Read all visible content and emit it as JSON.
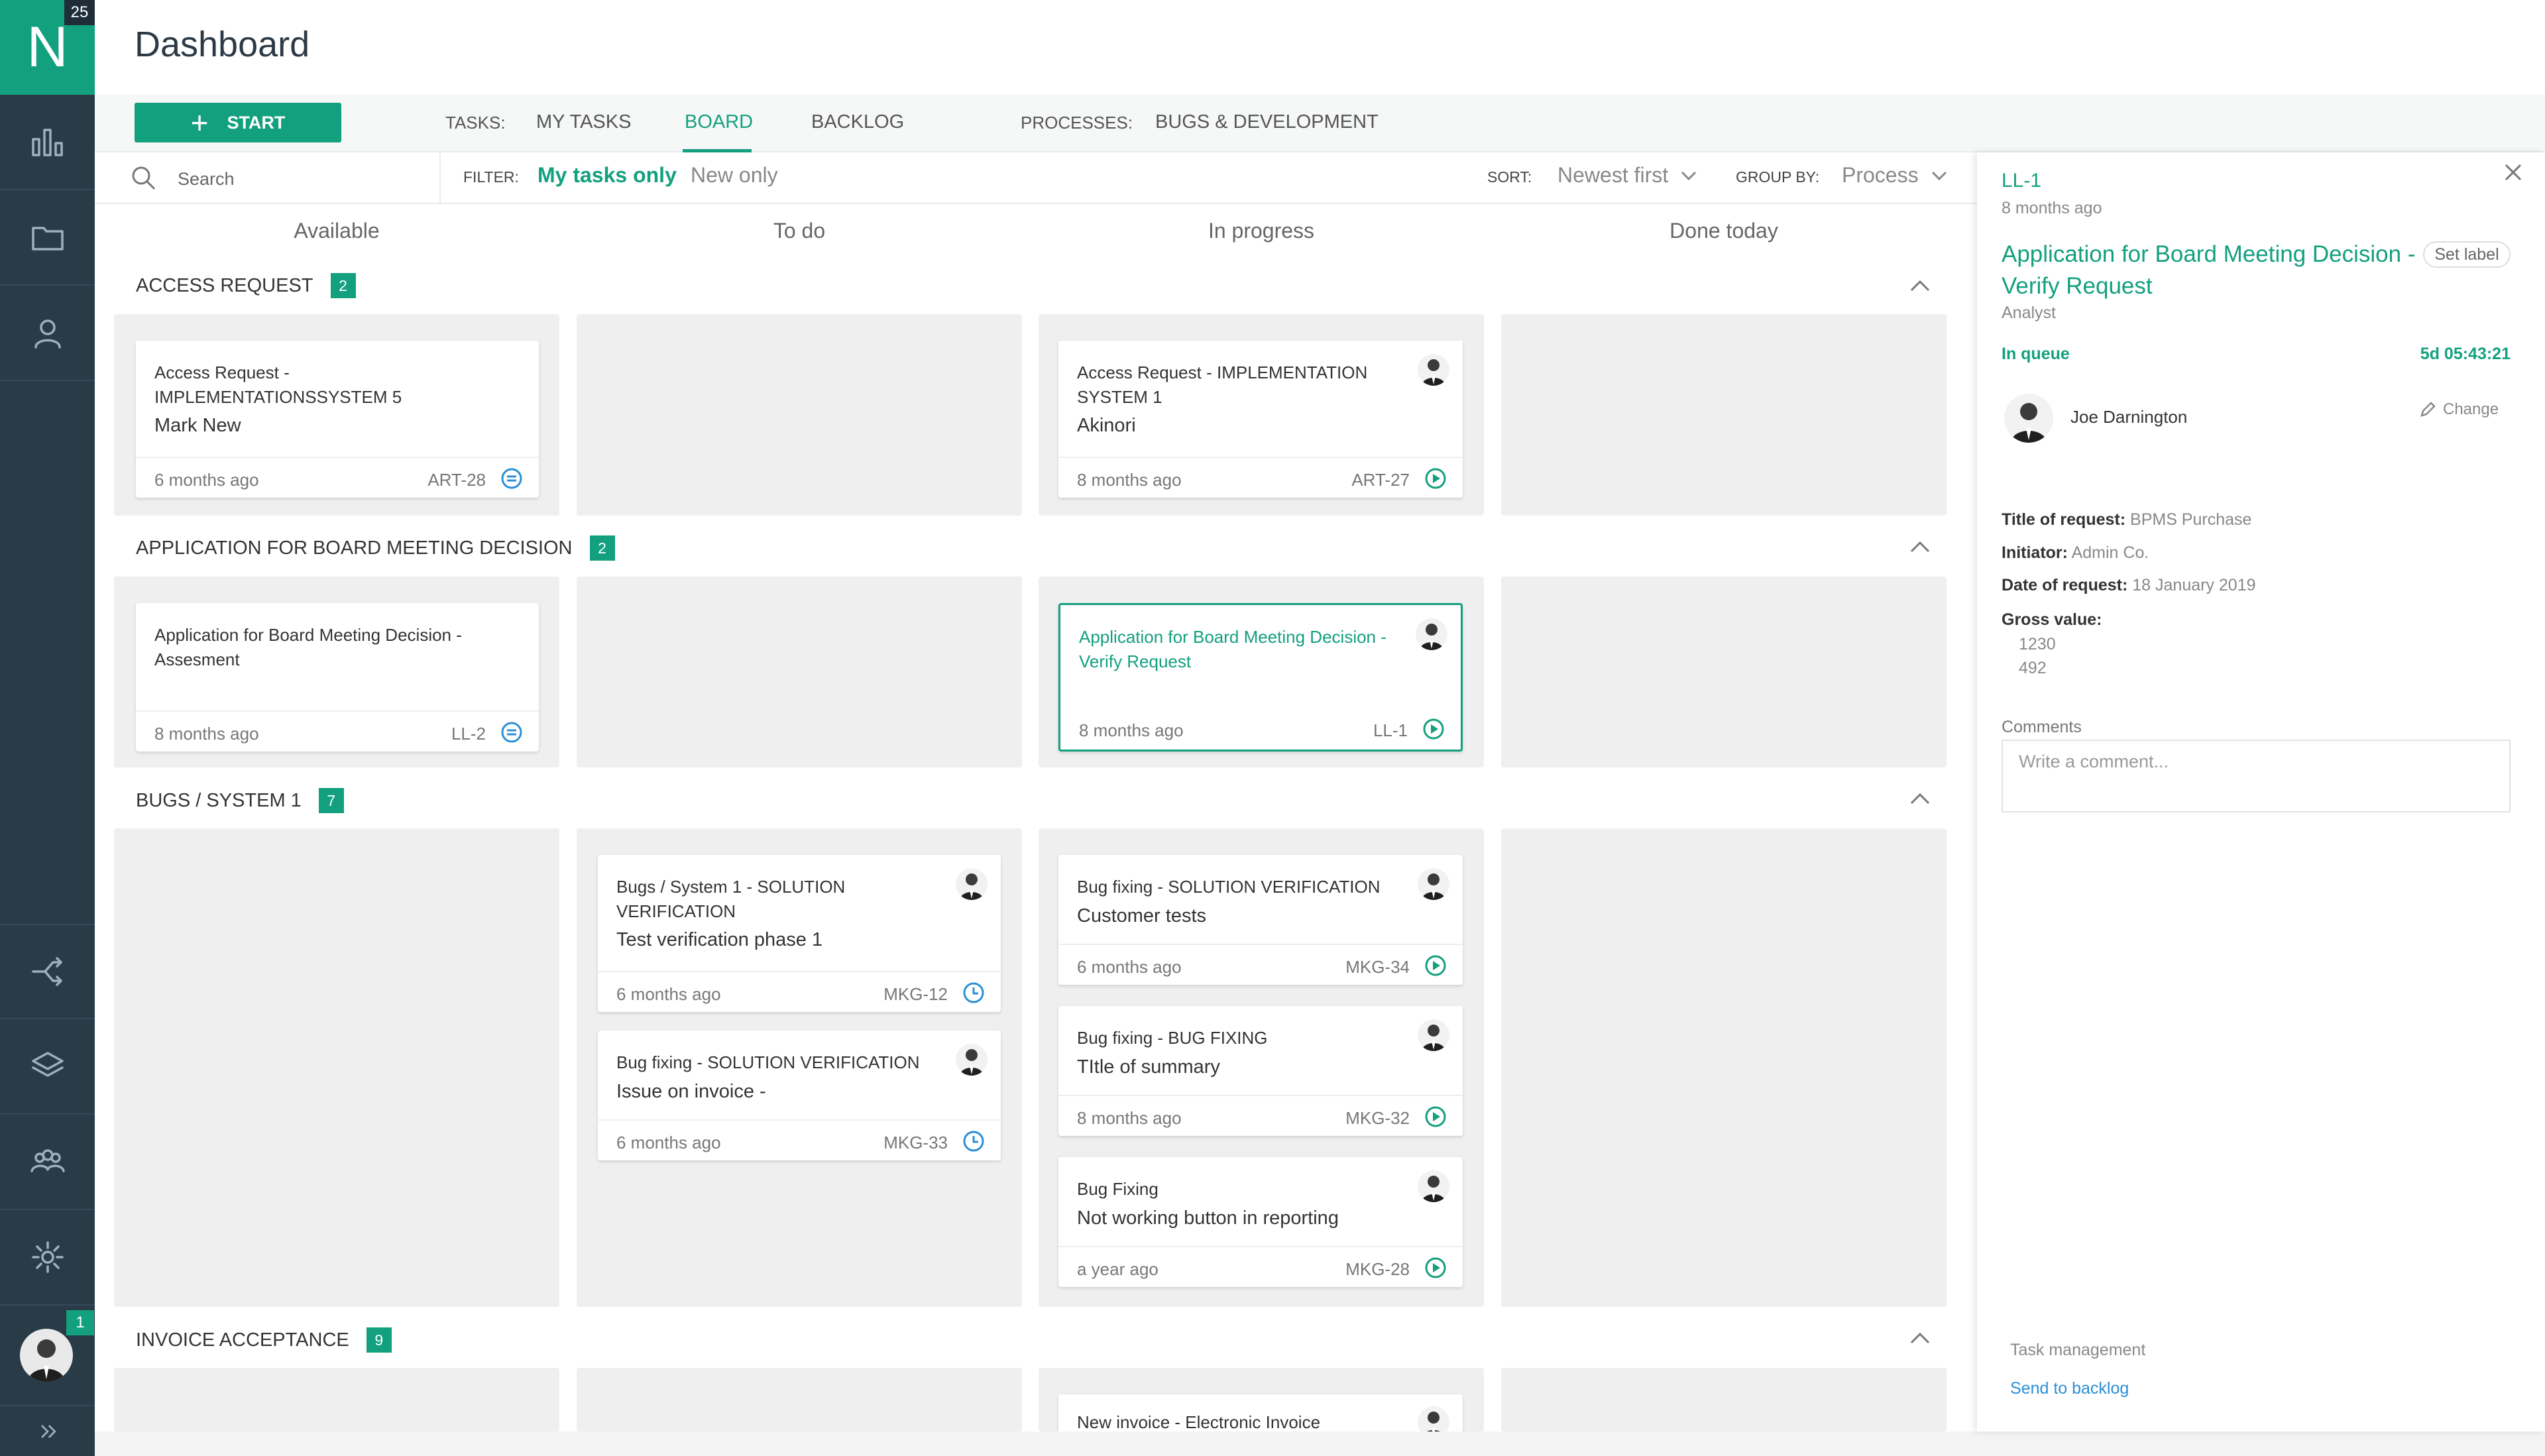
{
  "app": {
    "logo_letter": "N",
    "logo_badge": "25",
    "avatar_badge": "1"
  },
  "page": {
    "title": "Dashboard"
  },
  "sidebar": {
    "items": [
      {
        "icon": "bar-chart-icon"
      },
      {
        "icon": "folder-icon"
      },
      {
        "icon": "user-icon"
      },
      {
        "icon": "share-icon"
      },
      {
        "icon": "layers-icon"
      },
      {
        "icon": "team-icon"
      },
      {
        "icon": "gear-icon"
      }
    ],
    "expand_icon": "double-chevron-right-icon"
  },
  "toolbar": {
    "start_label": "START",
    "tasks_label": "TASKS:",
    "tabs": [
      {
        "label": "MY TASKS",
        "active": false
      },
      {
        "label": "BOARD",
        "active": true
      },
      {
        "label": "BACKLOG",
        "active": false
      }
    ],
    "processes_label": "PROCESSES:",
    "process_tab": "BUGS & DEVELOPMENT"
  },
  "filterbar": {
    "search_placeholder": "Search",
    "filter_label": "FILTER:",
    "filter_options": [
      {
        "label": "My tasks only",
        "active": true
      },
      {
        "label": "New only",
        "active": false
      }
    ],
    "sort_label": "SORT:",
    "sort_value": "Newest first",
    "group_label": "GROUP BY:",
    "group_value": "Process"
  },
  "board": {
    "columns": [
      "Available",
      "To do",
      "In progress",
      "Done today"
    ],
    "groups": [
      {
        "name": "ACCESS REQUEST",
        "count": "2",
        "cards": [
          {
            "title": "Access Request - IMPLEMENTATIONSSYSTEM 5",
            "subtitle": "Mark New",
            "date": "6 months ago",
            "id": "ART-28",
            "status": "list",
            "avatar": false
          },
          {
            "title": "Access Request - IMPLEMENTATION SYSTEM 1",
            "subtitle": "Akinori",
            "date": "8 months ago",
            "id": "ART-27",
            "status": "play",
            "avatar": true
          }
        ]
      },
      {
        "name": "APPLICATION FOR BOARD MEETING DECISION",
        "count": "2",
        "cards": [
          {
            "title": "Application for Board Meeting Decision - Assesment",
            "subtitle": "",
            "date": "8 months ago",
            "id": "LL-2",
            "status": "list",
            "avatar": false
          },
          {
            "title": "Application for Board Meeting Decision - Verify Request",
            "subtitle": "",
            "date": "8 months ago",
            "id": "LL-1",
            "status": "play",
            "avatar": true,
            "selected": true
          }
        ]
      },
      {
        "name": "BUGS / SYSTEM 1",
        "count": "7",
        "cards": [
          {
            "title": "Bugs / System 1 - SOLUTION VERIFICATION",
            "subtitle": "Test verification phase 1",
            "date": "6 months ago",
            "id": "MKG-12",
            "status": "clock",
            "avatar": true
          },
          {
            "title": "Bug fixing - SOLUTION VERIFICATION",
            "subtitle": "Issue on invoice -",
            "date": "6 months ago",
            "id": "MKG-33",
            "status": "clock",
            "avatar": true
          },
          {
            "title": "Bug fixing - SOLUTION VERIFICATION",
            "subtitle": "Customer tests",
            "date": "6 months ago",
            "id": "MKG-34",
            "status": "play",
            "avatar": true
          },
          {
            "title": "Bug fixing - BUG FIXING",
            "subtitle": "TItle of summary",
            "date": "8 months ago",
            "id": "MKG-32",
            "status": "play",
            "avatar": true
          },
          {
            "title": "Bug Fixing",
            "subtitle": "Not working button in reporting",
            "date": "a year ago",
            "id": "MKG-28",
            "status": "play",
            "avatar": true
          }
        ]
      },
      {
        "name": "INVOICE ACCEPTANCE",
        "count": "9",
        "cards": [
          {
            "title": "New invoice - Electronic Invoice",
            "subtitle": "",
            "date": "",
            "id": "",
            "status": "",
            "avatar": true
          }
        ]
      }
    ]
  },
  "panel": {
    "id": "LL-1",
    "age": "8 months ago",
    "title": "Application for Board Meeting Decision - Verify Request",
    "set_label": "Set label",
    "role": "Analyst",
    "status": "In queue",
    "timer": "5d 05:43:21",
    "assignee": "Joe Darnington",
    "change_label": "Change",
    "fields": {
      "title_label": "Title of request:",
      "title_value": "BPMS Purchase",
      "initiator_label": "Initiator:",
      "initiator_value": "Admin Co.",
      "date_label": "Date of request:",
      "date_value": "18 January 2019",
      "gross_label": "Gross value:",
      "gross_values": [
        "1230",
        "492"
      ]
    },
    "comments_label": "Comments",
    "comment_placeholder": "Write a comment...",
    "task_management_label": "Task management",
    "send_to_backlog": "Send to backlog"
  },
  "colors": {
    "accent": "#13a07f",
    "sidebar": "#2a3b48",
    "link": "#2b8fd6",
    "lane": "#efefef"
  }
}
